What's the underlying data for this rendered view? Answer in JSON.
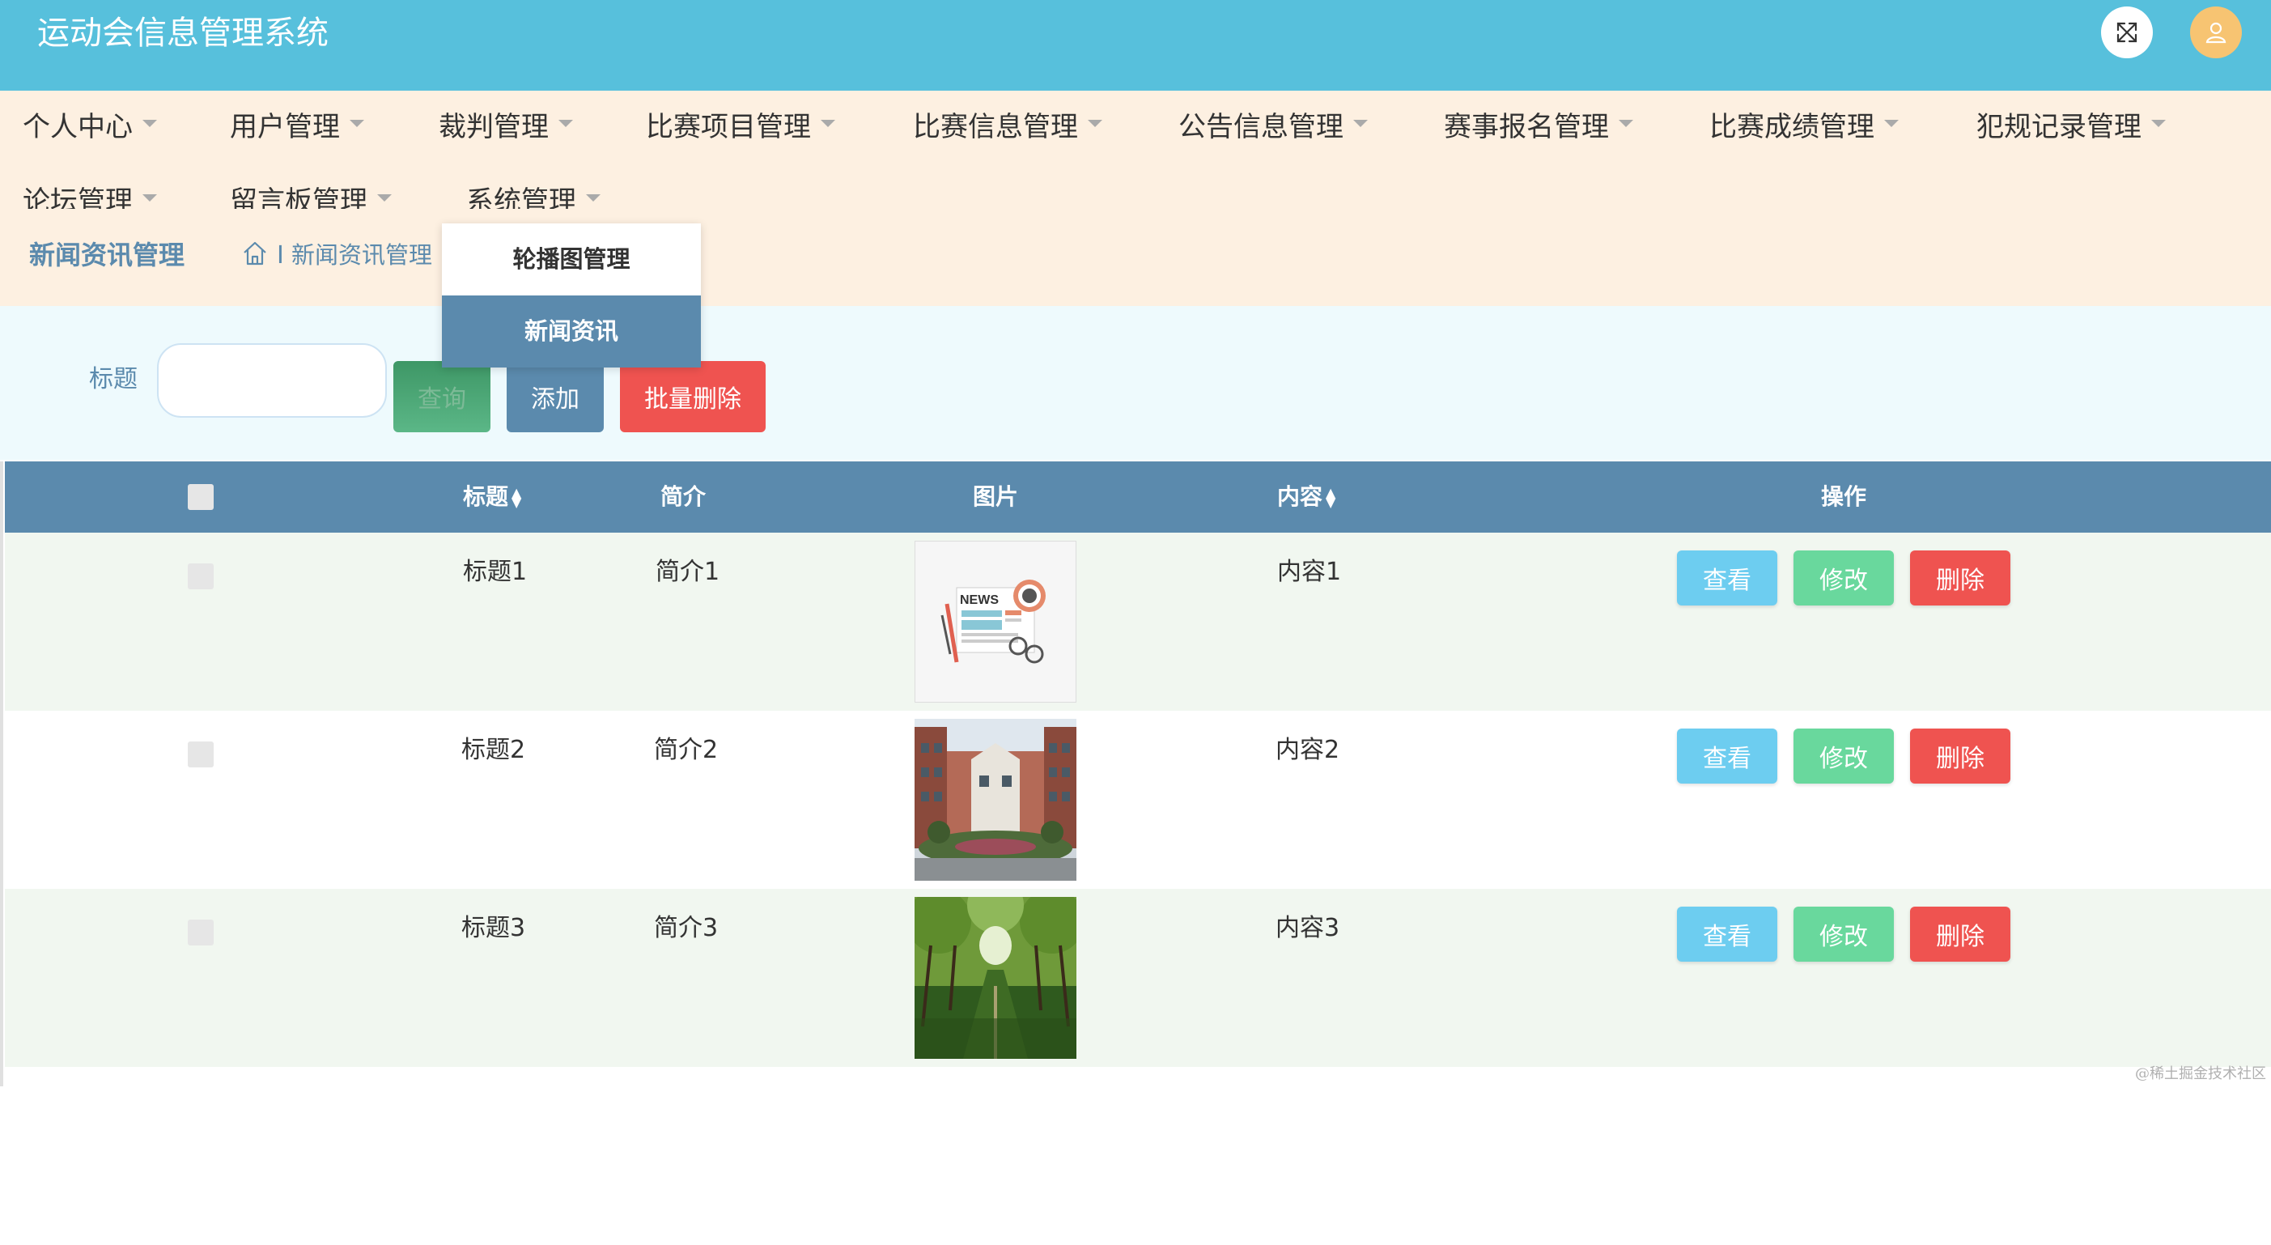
{
  "header": {
    "title": "运动会信息管理系统",
    "fullscreen_icon": "expand-icon",
    "user_icon": "user-icon",
    "color": "#57c0dc"
  },
  "nav": {
    "row1": [
      "个人中心",
      "用户管理",
      "裁判管理",
      "比赛项目管理",
      "比赛信息管理",
      "公告信息管理",
      "赛事报名管理",
      "比赛成绩管理",
      "犯规记录管理"
    ],
    "row2": [
      "论坛管理",
      "留言板管理",
      "系统管理"
    ],
    "background": "#fdf0e1"
  },
  "dropdown": {
    "items": [
      "轮播图管理",
      "新闻资讯"
    ],
    "active_index": 1
  },
  "breadcrumb": {
    "page_title": "新闻资讯管理",
    "home_icon": "home-icon",
    "separator": "I",
    "current": "新闻资讯管理"
  },
  "search": {
    "label": "标题",
    "value": "",
    "placeholder": "",
    "query_label": "查询",
    "add_label": "添加",
    "batch_delete_label": "批量删除"
  },
  "table": {
    "columns": {
      "title": "标题",
      "intro": "简介",
      "image": "图片",
      "content": "内容",
      "actions": "操作"
    },
    "sort_icon": "sort-icon",
    "rows": [
      {
        "title": "标题1",
        "intro": "简介1",
        "content": "内容1",
        "image": "news-illustration"
      },
      {
        "title": "标题2",
        "intro": "简介2",
        "content": "内容2",
        "image": "campus-building-photo"
      },
      {
        "title": "标题3",
        "intro": "简介3",
        "content": "内容3",
        "image": "tree-path-photo"
      }
    ],
    "actions": {
      "view": "查看",
      "edit": "修改",
      "delete": "删除"
    },
    "header_color": "#5b8aad"
  },
  "watermark": "@稀土掘金技术社区"
}
